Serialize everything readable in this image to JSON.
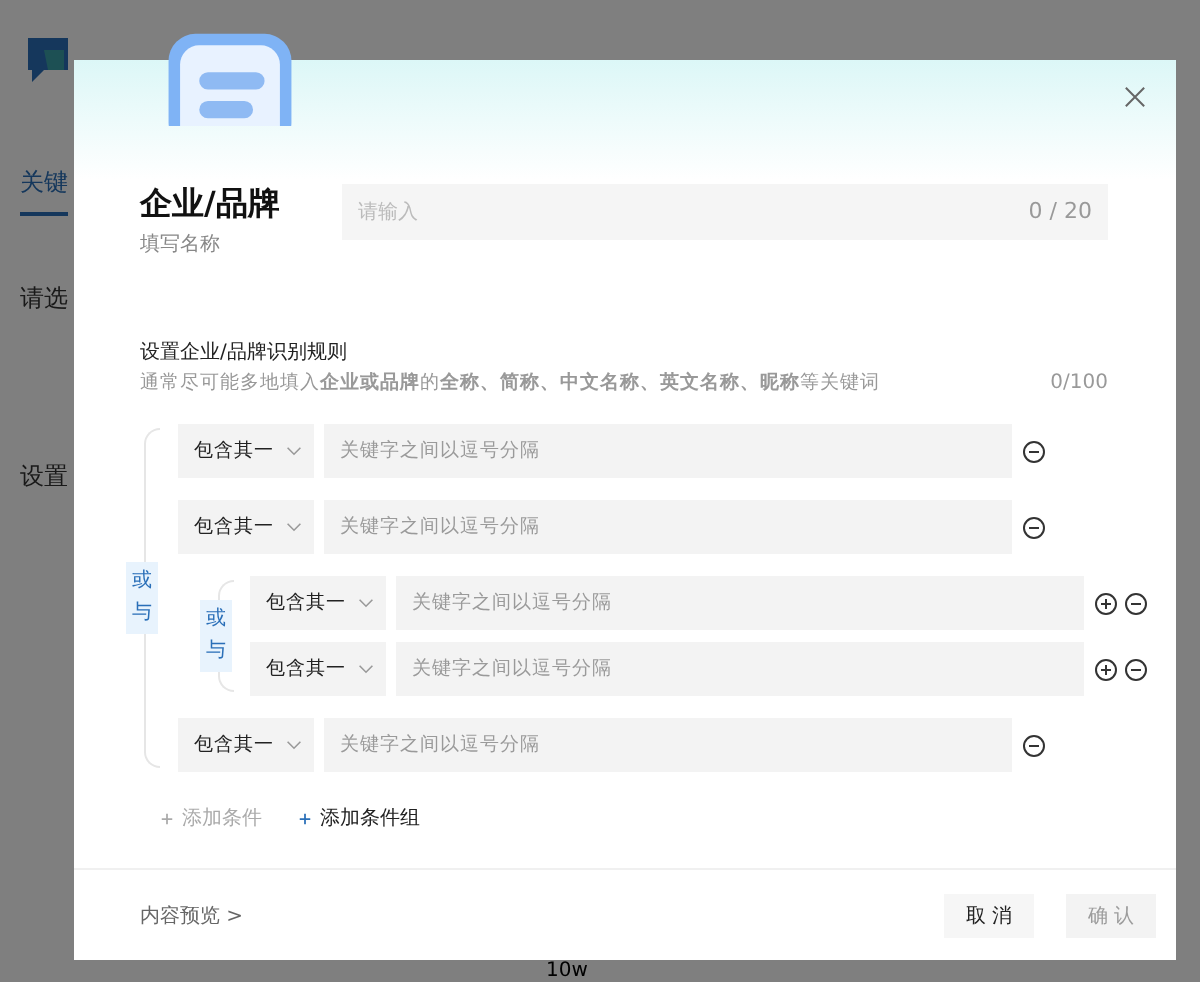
{
  "background": {
    "tab": "关键",
    "label_1": "请选",
    "label_2": "设置",
    "select_value": "10w"
  },
  "dialog": {
    "name": {
      "title": "企业/品牌",
      "subtitle": "填写名称",
      "placeholder": "请输入",
      "counter": "0 / 20"
    },
    "rules": {
      "title": "设置企业/品牌识别规则",
      "hint": "通常尽可能多地填入**企业或品牌**的**全称、简称、中文名称、英文名称、昵称**等关键词",
      "counter": "0/100",
      "tree": {
        "logic": "或与",
        "children": [
          {
            "kind": "condition",
            "operator": "包含其一",
            "placeholder": "关键字之间以逗号分隔",
            "can_add": false
          },
          {
            "kind": "condition",
            "operator": "包含其一",
            "placeholder": "关键字之间以逗号分隔",
            "can_add": false
          },
          {
            "kind": "group",
            "logic": "或与",
            "children": [
              {
                "kind": "condition",
                "operator": "包含其一",
                "placeholder": "关键字之间以逗号分隔",
                "can_add": true
              },
              {
                "kind": "condition",
                "operator": "包含其一",
                "placeholder": "关键字之间以逗号分隔",
                "can_add": true
              }
            ]
          },
          {
            "kind": "condition",
            "operator": "包含其一",
            "placeholder": "关键字之间以逗号分隔",
            "can_add": false
          }
        ]
      },
      "actions": [
        {
          "label": "添加条件",
          "disabled": true
        },
        {
          "label": "添加条件组",
          "disabled": false
        }
      ]
    },
    "footer": {
      "preview": "内容预览 >",
      "buttons": [
        {
          "label": "取 消",
          "disabled": false
        },
        {
          "label": "确 认",
          "disabled": true
        }
      ]
    }
  }
}
